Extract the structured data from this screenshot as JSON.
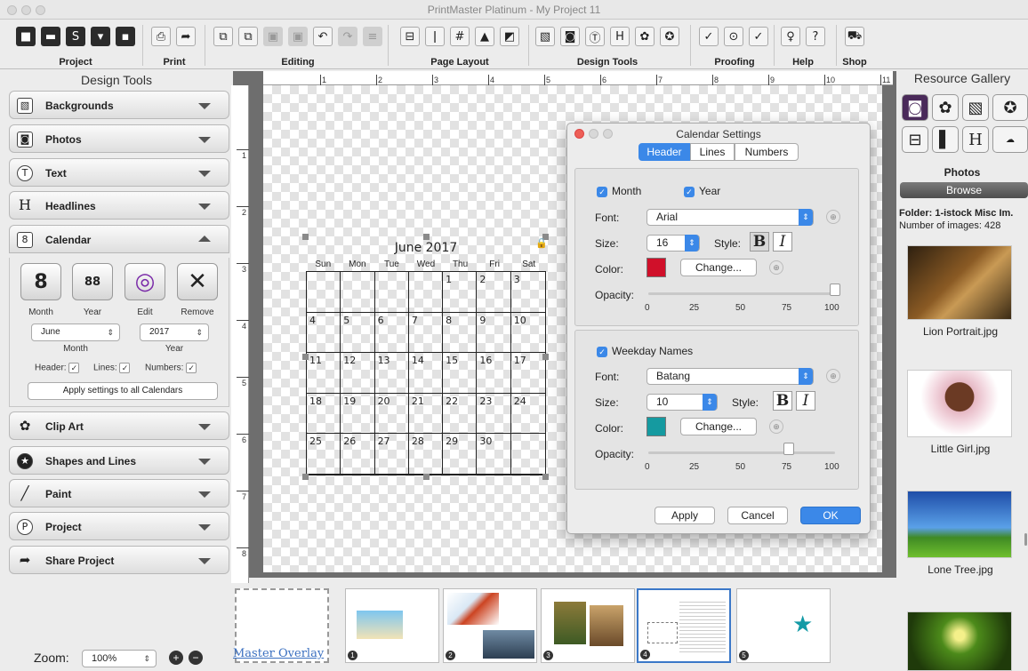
{
  "window": {
    "title": "PrintMaster Platinum - My Project 11"
  },
  "toolbar": {
    "groups": [
      {
        "label": "Project"
      },
      {
        "label": "Print"
      },
      {
        "label": "Editing"
      },
      {
        "label": "Page Layout"
      },
      {
        "label": "Design Tools"
      },
      {
        "label": "Proofing"
      },
      {
        "label": "Help"
      },
      {
        "label": "Shop"
      }
    ]
  },
  "ruler": {
    "marks": [
      "1",
      "2",
      "3",
      "4",
      "5",
      "6",
      "7",
      "8",
      "9",
      "10",
      "11"
    ],
    "vmarks": [
      "1",
      "2",
      "3",
      "4",
      "5",
      "6",
      "7",
      "8"
    ]
  },
  "design_tools": {
    "title": "Design Tools",
    "panels": [
      {
        "label": "Backgrounds"
      },
      {
        "label": "Photos"
      },
      {
        "label": "Text"
      },
      {
        "label": "Headlines"
      },
      {
        "label": "Calendar"
      },
      {
        "label": "Clip Art"
      },
      {
        "label": "Shapes and Lines"
      },
      {
        "label": "Paint"
      },
      {
        "label": "Project"
      },
      {
        "label": "Share Project"
      }
    ],
    "calendar": {
      "buttons": [
        "Month",
        "Year",
        "Edit",
        "Remove"
      ],
      "month_value": "June",
      "year_value": "2017",
      "month_label": "Month",
      "year_label": "Year",
      "header_label": "Header:",
      "lines_label": "Lines:",
      "numbers_label": "Numbers:",
      "apply_all": "Apply settings to all Calendars"
    }
  },
  "zoom": {
    "label": "Zoom:",
    "value": "100%"
  },
  "calendar": {
    "title": "June 2017",
    "weekdays": [
      "Sun",
      "Mon",
      "Tue",
      "Wed",
      "Thu",
      "Fri",
      "Sat"
    ],
    "cells": [
      "",
      "",
      "",
      "",
      "1",
      "2",
      "3",
      "4",
      "5",
      "6",
      "7",
      "8",
      "9",
      "10",
      "11",
      "12",
      "13",
      "14",
      "15",
      "16",
      "17",
      "18",
      "19",
      "20",
      "21",
      "22",
      "23",
      "24",
      "25",
      "26",
      "27",
      "28",
      "29",
      "30",
      ""
    ]
  },
  "dialog": {
    "title": "Calendar Settings",
    "tabs": [
      "Header",
      "Lines",
      "Numbers"
    ],
    "header": {
      "month": "Month",
      "year": "Year",
      "font_label": "Font:",
      "font": "Arial",
      "size_label": "Size:",
      "size": "16",
      "style_label": "Style:",
      "color_label": "Color:",
      "color": "#d0102a",
      "change": "Change...",
      "opacity_label": "Opacity:",
      "opacity": 100
    },
    "weekday": {
      "title": "Weekday Names",
      "font_label": "Font:",
      "font": "Batang",
      "size_label": "Size:",
      "size": "10",
      "style_label": "Style:",
      "color_label": "Color:",
      "color": "#159aa0",
      "change": "Change...",
      "opacity_label": "Opacity:",
      "opacity": 75
    },
    "ticks": [
      "0",
      "25",
      "50",
      "75",
      "100"
    ],
    "apply": "Apply",
    "cancel": "Cancel",
    "ok": "OK"
  },
  "resource_gallery": {
    "title": "Resource Gallery",
    "section": "Photos",
    "browse": "Browse",
    "folder": "Folder: 1-istock Misc Im.",
    "count": "Number of images: 428",
    "items": [
      {
        "caption": "Lion Portrait.jpg"
      },
      {
        "caption": "Little Girl.jpg"
      },
      {
        "caption": "Lone Tree.jpg"
      }
    ]
  },
  "filmstrip": {
    "master": "Master Overlay",
    "pages": [
      "1",
      "2",
      "3",
      "4",
      "5"
    ]
  }
}
